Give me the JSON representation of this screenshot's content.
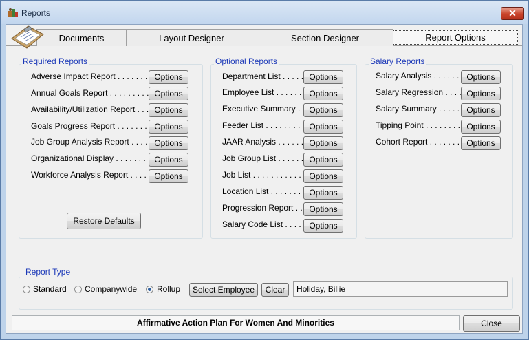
{
  "window": {
    "title": "Reports"
  },
  "tabs": [
    "Documents",
    "Layout Designer",
    "Section Designer",
    "Report Options"
  ],
  "required": {
    "legend": "Required Reports",
    "items": [
      "Adverse Impact Report",
      "Annual Goals Report",
      "Availability/Utilization Report",
      "Goals Progress Report",
      "Job Group Analysis Report",
      "Organizational Display",
      "Workforce Analysis Report"
    ],
    "restore_label": "Restore Defaults"
  },
  "optional": {
    "legend": "Optional Reports",
    "items": [
      "Department List",
      "Employee List",
      "Executive Summary",
      "Feeder List",
      "JAAR Analysis",
      "Job Group List",
      "Job List",
      "Location List",
      "Progression Report",
      "Salary Code List"
    ]
  },
  "salary": {
    "legend": "Salary Reports",
    "items": [
      "Salary Analysis",
      "Salary Regression",
      "Salary Summary",
      "Tipping Point",
      "Cohort Report"
    ]
  },
  "options_label": "Options",
  "report_type": {
    "legend": "Report Type",
    "options": [
      "Standard",
      "Companywide",
      "Rollup"
    ],
    "selected": "Rollup",
    "select_employee_label": "Select Employee",
    "clear_label": "Clear",
    "employee_value": "Holiday, Billie"
  },
  "footer": {
    "plan_title": "Affirmative Action Plan For Women And Minorities",
    "close_label": "Close"
  }
}
